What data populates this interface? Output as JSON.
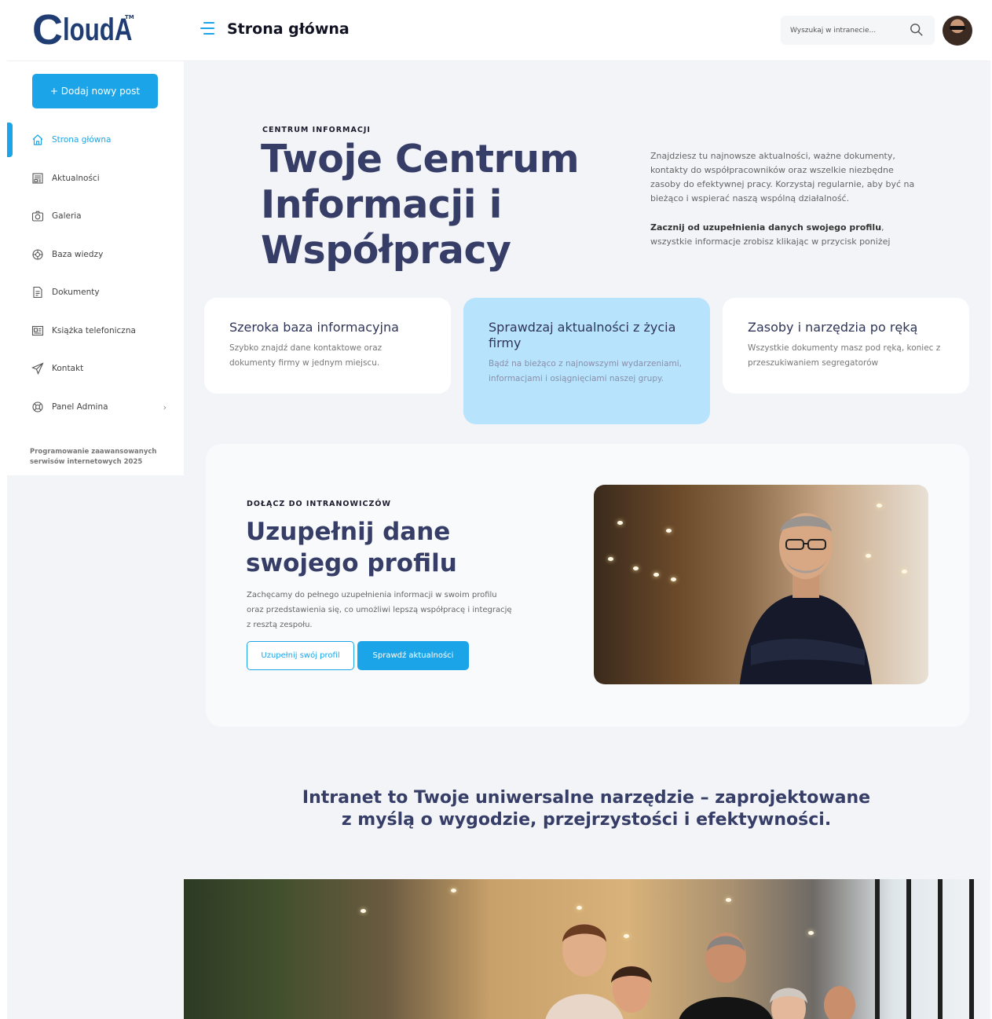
{
  "header": {
    "logo_c": "C",
    "logo_rest": "loudA",
    "logo_tm": "TM",
    "page_title": "Strona główna",
    "search_placeholder": "Wyszukaj w intranecie..."
  },
  "sidebar": {
    "new_post_label": "+ Dodaj nowy post",
    "items": [
      {
        "label": "Strona główna",
        "icon": "home-icon",
        "active": true
      },
      {
        "label": "Aktualności",
        "icon": "newspaper-icon"
      },
      {
        "label": "Galeria",
        "icon": "camera-icon"
      },
      {
        "label": "Baza wiedzy",
        "icon": "lifebuoy-icon"
      },
      {
        "label": "Dokumenty",
        "icon": "document-icon"
      },
      {
        "label": "Książka telefoniczna",
        "icon": "contact-card-icon"
      },
      {
        "label": "Kontakt",
        "icon": "paper-plane-icon"
      },
      {
        "label": "Panel Admina",
        "icon": "gear-icon",
        "has_submenu": true
      }
    ],
    "footer_text": "Programowanie zaawansowanych serwisów internetowych 2025"
  },
  "hero": {
    "eyebrow": "CENTRUM INFORMACJI",
    "title": "Twoje Centrum Informacji i Współpracy",
    "description": "Znajdziesz tu najnowsze aktualności, ważne dokumenty, kontakty do współpracowników oraz wszelkie niezbędne zasoby do efektywnej pracy. Korzystaj regularnie, aby być na bieżąco i wspierać naszą wspólną działalność.",
    "cta_bold": "Zacznij od uzupełnienia danych swojego profilu",
    "cta_rest": ", wszystkie informacje zrobisz klikając w przycisk poniżej"
  },
  "cards": [
    {
      "title": "Szeroka baza informacyjna",
      "text": "Szybko znajdź dane kontaktowe oraz dokumenty firmy w jednym miejscu."
    },
    {
      "title": "Sprawdzaj aktualności z życia firmy",
      "text": "Bądź na bieżąco z najnowszymi wydarzeniami, informacjami i osiągnięciami naszej grupy."
    },
    {
      "title": "Zasoby i narzędzia po ręką",
      "text": "Wszystkie dokumenty masz pod ręką, koniec z przeszukiwaniem segregatorów"
    }
  ],
  "profile": {
    "eyebrow": "DOŁĄCZ DO INTRANOWICZÓW",
    "title": "Uzupełnij dane swojego profilu",
    "description": "Zachęcamy do pełnego uzupełnienia informacji w swoim profilu oraz przedstawienia się, co umożliwi lepszą współpracę i integrację z resztą zespołu.",
    "btn_complete": "Uzupełnij swój profil",
    "btn_news": "Sprawdź aktualności"
  },
  "tagline": "Intranet to Twoje uniwersalne narzędzie – zaprojektowane z myślą o wygodzie, przejrzystości i efektywności.",
  "colors": {
    "accent": "#1ba5e8",
    "heading": "#363e68",
    "highlight_card": "#b7e3fd",
    "main_bg": "#f2f4f7"
  }
}
